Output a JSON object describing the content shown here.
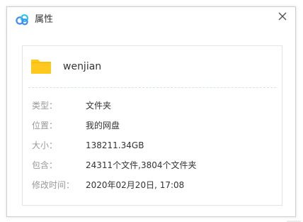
{
  "window": {
    "title": "属性",
    "logo_icon": "baidu-netdisk-cloud-icon",
    "close_icon": "close-icon"
  },
  "file": {
    "name": "wenjian",
    "icon": "folder-icon",
    "icon_color": "#FFC81E"
  },
  "properties": [
    {
      "label": "类型：",
      "value": "文件夹"
    },
    {
      "label": "位置：",
      "value": "我的网盘"
    },
    {
      "label": "大小：",
      "value": "138211.34GB"
    },
    {
      "label": "包含：",
      "value": "24311个文件,3804个文件夹"
    },
    {
      "label": "修改时间：",
      "value": "2020年02月20日, 17:08"
    }
  ],
  "colors": {
    "label_text": "#999999",
    "value_text": "#333333",
    "divider": "#cfe3f1",
    "logo_blue": "#3f8cf5",
    "logo_cyan": "#2bc3e8"
  }
}
